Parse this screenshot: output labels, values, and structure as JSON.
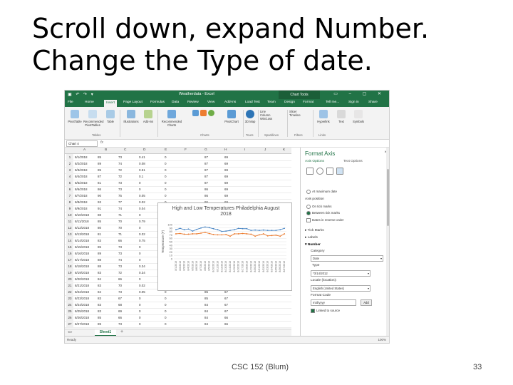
{
  "slide": {
    "title_line1": "Scroll down, expand Number.",
    "title_line2": "Change the Type of date.",
    "footer_center": "CSC 152 (Blum)",
    "page_number": "33"
  },
  "excel": {
    "doc_title": "Weatherdata - Excel",
    "context_tab": "Chart Tools",
    "tabs": [
      "File",
      "Home",
      "Insert",
      "Page Layout",
      "Formulas",
      "Data",
      "Review",
      "View",
      "Add-ins",
      "Load Test",
      "Team",
      "Design",
      "Format"
    ],
    "active_tab": "Insert",
    "tell_me": "Tell me...",
    "sign_in": "Sign in",
    "share": "Share",
    "ribbon": {
      "buttons": [
        "PivotTable",
        "Recommended PivotTables",
        "Table",
        "Illustrations",
        "Add-ins",
        "Recommended Charts",
        "PivotChart",
        "3D Map",
        "Line",
        "Column",
        "Win/Loss",
        "Slicer",
        "Timeline",
        "Hyperlink",
        "Text",
        "Symbols"
      ],
      "groups": [
        "Tables",
        "Charts",
        "Tours",
        "Sparklines",
        "Filters",
        "Links"
      ]
    },
    "name_box": "Chart 4",
    "fx": "fx",
    "columns": [
      "A",
      "B",
      "C",
      "D",
      "E",
      "F",
      "G",
      "H",
      "I",
      "J",
      "K"
    ],
    "rows": [
      {
        "n": "1",
        "a": "8/1/2018",
        "b": "85",
        "c": "73",
        "d": "0.41",
        "e": "0",
        "g": "87",
        "h": "69"
      },
      {
        "n": "2",
        "a": "8/2/2018",
        "b": "89",
        "c": "74",
        "d": "0.08",
        "e": "0",
        "g": "87",
        "h": "69"
      },
      {
        "n": "3",
        "a": "8/3/2018",
        "b": "85",
        "c": "72",
        "d": "0.51",
        "e": "0",
        "g": "87",
        "h": "69"
      },
      {
        "n": "4",
        "a": "8/4/2018",
        "b": "87",
        "c": "72",
        "d": "0.1",
        "e": "0",
        "g": "87",
        "h": "69"
      },
      {
        "n": "5",
        "a": "8/5/2018",
        "b": "81",
        "c": "73",
        "d": "0",
        "e": "0",
        "g": "87",
        "h": "69"
      },
      {
        "n": "6",
        "a": "8/6/2018",
        "b": "86",
        "c": "73",
        "d": "0",
        "e": "0",
        "g": "86",
        "h": "69"
      },
      {
        "n": "7",
        "a": "8/7/2018",
        "b": "90",
        "c": "75",
        "d": "0.05",
        "e": "0",
        "g": "86",
        "h": "69"
      },
      {
        "n": "8",
        "a": "8/8/2018",
        "b": "93",
        "c": "77",
        "d": "0.02",
        "e": "0",
        "g": "86",
        "h": "69"
      },
      {
        "n": "9",
        "a": "8/9/2018",
        "b": "91",
        "c": "74",
        "d": "0.04",
        "e": "0",
        "g": "86",
        "h": "69"
      },
      {
        "n": "10",
        "a": "8/10/2018",
        "b": "88",
        "c": "71",
        "d": "0",
        "e": "0",
        "g": "86",
        "h": "69"
      },
      {
        "n": "11",
        "a": "8/11/2018",
        "b": "85",
        "c": "70",
        "d": "0.79",
        "e": "0",
        "g": "86",
        "h": "68"
      },
      {
        "n": "12",
        "a": "8/12/2018",
        "b": "80",
        "c": "70",
        "d": "0",
        "e": "0",
        "g": "86",
        "h": "68"
      },
      {
        "n": "13",
        "a": "8/13/2018",
        "b": "81",
        "c": "71",
        "d": "0.32",
        "e": "0",
        "g": "86",
        "h": "68"
      },
      {
        "n": "14",
        "a": "8/14/2018",
        "b": "83",
        "c": "66",
        "d": "0.75",
        "e": "0",
        "g": "86",
        "h": "68"
      },
      {
        "n": "15",
        "a": "8/15/2018",
        "b": "85",
        "c": "73",
        "d": "0",
        "e": "0",
        "g": "86",
        "h": "68"
      },
      {
        "n": "16",
        "a": "8/16/2018",
        "b": "89",
        "c": "73",
        "d": "0",
        "e": "0",
        "g": "86",
        "h": "68"
      },
      {
        "n": "17",
        "a": "8/17/2018",
        "b": "88",
        "c": "74",
        "d": "0",
        "e": "0",
        "g": "85",
        "h": "68"
      },
      {
        "n": "18",
        "a": "8/18/2018",
        "b": "88",
        "c": "73",
        "d": "0.34",
        "e": "0",
        "g": "85",
        "h": "68"
      },
      {
        "n": "19",
        "a": "8/19/2018",
        "b": "83",
        "c": "72",
        "d": "0.34",
        "e": "0",
        "g": "85",
        "h": "68"
      },
      {
        "n": "20",
        "a": "8/20/2018",
        "b": "84",
        "c": "66",
        "d": "0",
        "e": "0",
        "g": "85",
        "h": "67"
      },
      {
        "n": "21",
        "a": "8/21/2018",
        "b": "83",
        "c": "70",
        "d": "0.02",
        "e": "0",
        "g": "85",
        "h": "67"
      },
      {
        "n": "22",
        "a": "8/22/2018",
        "b": "84",
        "c": "73",
        "d": "0.05",
        "e": "0",
        "g": "85",
        "h": "67"
      },
      {
        "n": "23",
        "a": "8/23/2018",
        "b": "83",
        "c": "67",
        "d": "0",
        "e": "0",
        "g": "85",
        "h": "67"
      },
      {
        "n": "24",
        "a": "8/24/2018",
        "b": "83",
        "c": "68",
        "d": "0",
        "e": "0",
        "g": "84",
        "h": "67"
      },
      {
        "n": "25",
        "a": "8/25/2018",
        "b": "83",
        "c": "69",
        "d": "0",
        "e": "0",
        "g": "84",
        "h": "67"
      },
      {
        "n": "26",
        "a": "8/26/2018",
        "b": "85",
        "c": "66",
        "d": "0",
        "e": "0",
        "g": "84",
        "h": "66"
      },
      {
        "n": "27",
        "a": "8/27/2018",
        "b": "89",
        "c": "73",
        "d": "0",
        "e": "0",
        "g": "84",
        "h": "66"
      }
    ],
    "sheet_tab": "Sheet1",
    "add_sheet": "+",
    "status_ready": "Ready",
    "zoom": "100%"
  },
  "chart_data": {
    "type": "line",
    "title": "High and Low Temperatures Philadelphia August 2018",
    "ylabel": "Temperature (F)",
    "xlabel": "",
    "x": [
      "8/1/2018",
      "8/2/2018",
      "8/3/2018",
      "8/4/2018",
      "8/5/2018",
      "8/6/2018",
      "8/7/2018",
      "8/8/2018",
      "8/9/2018",
      "8/10/2018",
      "8/11/2018",
      "8/12/2018",
      "8/13/2018",
      "8/14/2018",
      "8/15/2018",
      "8/16/2018",
      "8/17/2018",
      "8/18/2018",
      "8/19/2018",
      "8/20/2018",
      "8/21/2018",
      "8/22/2018",
      "8/23/2018",
      "8/24/2018",
      "8/25/2018",
      "8/26/2018",
      "8/27/2018"
    ],
    "ylim": [
      0,
      100
    ],
    "yticks": [
      "0",
      "10",
      "20",
      "30",
      "40",
      "50",
      "60",
      "70",
      "80",
      "90",
      "100"
    ],
    "series": [
      {
        "values": [
          85,
          89,
          85,
          87,
          81,
          86,
          90,
          93,
          91,
          88,
          85,
          80,
          81,
          83,
          85,
          89,
          88,
          88,
          83,
          84,
          83,
          84,
          83,
          83,
          83,
          85,
          89
        ],
        "color": "#4a86c5"
      },
      {
        "values": [
          73,
          74,
          72,
          72,
          73,
          73,
          75,
          77,
          74,
          71,
          70,
          70,
          71,
          66,
          73,
          73,
          74,
          73,
          72,
          66,
          70,
          73,
          67,
          68,
          69,
          66,
          73
        ],
        "color": "#ed7d31"
      }
    ],
    "grid": true
  },
  "format_pane": {
    "title": "Format Axis",
    "close": "×",
    "axis_options": "Axis Options",
    "text_options": "Text Options",
    "at_max": "At maximum date",
    "axis_position": "Axis position",
    "on_tick": "On tick marks",
    "between_tick": "Between tick marks",
    "reverse": "Dates in reverse order",
    "tick_marks": "Tick Marks",
    "labels": "Labels",
    "number": "Number",
    "category_label": "Category",
    "category_value": "Date",
    "type_label": "Type",
    "type_value": "*3/14/2012",
    "locale_label": "Locale (location):",
    "locale_value": "English (United States)",
    "format_code_label": "Format Code",
    "format_code_value": "m/d/yyyy",
    "add_button": "Add",
    "linked": "Linked to source"
  }
}
